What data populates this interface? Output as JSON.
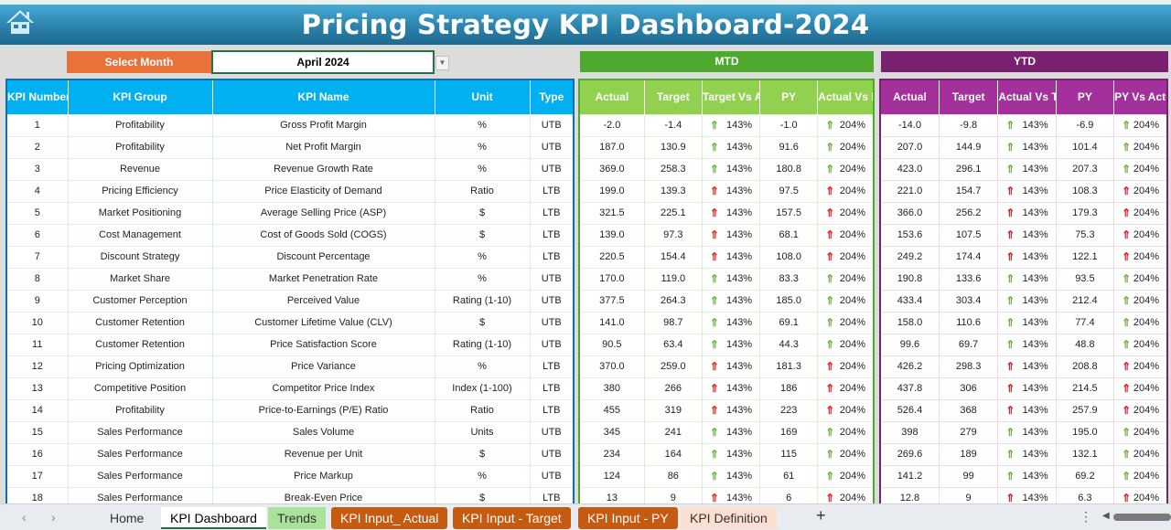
{
  "title": "Pricing Strategy KPI Dashboard-2024",
  "selector": {
    "label": "Select Month",
    "value": "April 2024"
  },
  "sections": {
    "mtd": "MTD",
    "ytd": "YTD"
  },
  "main_headers": [
    "KPI Number",
    "KPI Group",
    "KPI Name",
    "Unit",
    "Type"
  ],
  "mtd_headers": [
    "Actual",
    "Target",
    "Target Vs Actual",
    "PY",
    "Actual Vs PY"
  ],
  "ytd_headers": [
    "Actual",
    "Target",
    "Actual Vs Target",
    "PY",
    "PY Vs Actual"
  ],
  "colors": {
    "good": "#6cb33f",
    "bad": "#e02020",
    "mtd": "#4fa92f",
    "ytd": "#7a2070",
    "main": "#00b0f0",
    "select": "#e9723a"
  },
  "rows": [
    {
      "num": "1",
      "group": "Profitability",
      "name": "Gross Profit Margin",
      "unit": "%",
      "type": "UTB",
      "mtd": [
        "-2.0",
        "-1.4",
        "143%",
        "-1.0",
        "204%"
      ],
      "ytd": [
        "-14.0",
        "-9.8",
        "143%",
        "-6.9",
        "204%"
      ],
      "status": "good"
    },
    {
      "num": "2",
      "group": "Profitability",
      "name": "Net Profit Margin",
      "unit": "%",
      "type": "UTB",
      "mtd": [
        "187.0",
        "130.9",
        "143%",
        "91.6",
        "204%"
      ],
      "ytd": [
        "207.0",
        "144.9",
        "143%",
        "101.4",
        "204%"
      ],
      "status": "good"
    },
    {
      "num": "3",
      "group": "Revenue",
      "name": "Revenue Growth Rate",
      "unit": "%",
      "type": "UTB",
      "mtd": [
        "369.0",
        "258.3",
        "143%",
        "180.8",
        "204%"
      ],
      "ytd": [
        "423.0",
        "296.1",
        "143%",
        "207.3",
        "204%"
      ],
      "status": "good"
    },
    {
      "num": "4",
      "group": "Pricing Efficiency",
      "name": "Price Elasticity of Demand",
      "unit": "Ratio",
      "type": "LTB",
      "mtd": [
        "199.0",
        "139.3",
        "143%",
        "97.5",
        "204%"
      ],
      "ytd": [
        "221.0",
        "154.7",
        "143%",
        "108.3",
        "204%"
      ],
      "status": "bad"
    },
    {
      "num": "5",
      "group": "Market Positioning",
      "name": "Average Selling Price (ASP)",
      "unit": "$",
      "type": "LTB",
      "mtd": [
        "321.5",
        "225.1",
        "143%",
        "157.5",
        "204%"
      ],
      "ytd": [
        "366.0",
        "256.2",
        "143%",
        "179.3",
        "204%"
      ],
      "status": "bad"
    },
    {
      "num": "6",
      "group": "Cost Management",
      "name": "Cost of Goods Sold (COGS)",
      "unit": "$",
      "type": "LTB",
      "mtd": [
        "139.0",
        "97.3",
        "143%",
        "68.1",
        "204%"
      ],
      "ytd": [
        "153.6",
        "107.5",
        "143%",
        "75.3",
        "204%"
      ],
      "status": "bad"
    },
    {
      "num": "7",
      "group": "Discount Strategy",
      "name": "Discount Percentage",
      "unit": "%",
      "type": "LTB",
      "mtd": [
        "220.5",
        "154.4",
        "143%",
        "108.0",
        "204%"
      ],
      "ytd": [
        "249.2",
        "174.4",
        "143%",
        "122.1",
        "204%"
      ],
      "status": "bad"
    },
    {
      "num": "8",
      "group": "Market Share",
      "name": "Market Penetration Rate",
      "unit": "%",
      "type": "UTB",
      "mtd": [
        "170.0",
        "119.0",
        "143%",
        "83.3",
        "204%"
      ],
      "ytd": [
        "190.8",
        "133.6",
        "143%",
        "93.5",
        "204%"
      ],
      "status": "good"
    },
    {
      "num": "9",
      "group": "Customer Perception",
      "name": "Perceived Value",
      "unit": "Rating (1-10)",
      "type": "UTB",
      "mtd": [
        "377.5",
        "264.3",
        "143%",
        "185.0",
        "204%"
      ],
      "ytd": [
        "433.4",
        "303.4",
        "143%",
        "212.4",
        "204%"
      ],
      "status": "good"
    },
    {
      "num": "10",
      "group": "Customer Retention",
      "name": "Customer Lifetime Value (CLV)",
      "unit": "$",
      "type": "UTB",
      "mtd": [
        "141.0",
        "98.7",
        "143%",
        "69.1",
        "204%"
      ],
      "ytd": [
        "158.0",
        "110.6",
        "143%",
        "77.4",
        "204%"
      ],
      "status": "good"
    },
    {
      "num": "11",
      "group": "Customer Retention",
      "name": "Price Satisfaction Score",
      "unit": "Rating (1-10)",
      "type": "UTB",
      "mtd": [
        "90.5",
        "63.4",
        "143%",
        "44.3",
        "204%"
      ],
      "ytd": [
        "99.6",
        "69.7",
        "143%",
        "48.8",
        "204%"
      ],
      "status": "good"
    },
    {
      "num": "12",
      "group": "Pricing Optimization",
      "name": "Price Variance",
      "unit": "%",
      "type": "LTB",
      "mtd": [
        "370.0",
        "259.0",
        "143%",
        "181.3",
        "204%"
      ],
      "ytd": [
        "426.2",
        "298.3",
        "143%",
        "208.8",
        "204%"
      ],
      "status": "bad"
    },
    {
      "num": "13",
      "group": "Competitive Position",
      "name": "Competitor Price Index",
      "unit": "Index (1-100)",
      "type": "LTB",
      "mtd": [
        "380",
        "266",
        "143%",
        "186",
        "204%"
      ],
      "ytd": [
        "437.8",
        "306",
        "143%",
        "214.5",
        "204%"
      ],
      "status": "bad"
    },
    {
      "num": "14",
      "group": "Profitability",
      "name": "Price-to-Earnings (P/E) Ratio",
      "unit": "Ratio",
      "type": "LTB",
      "mtd": [
        "455",
        "319",
        "143%",
        "223",
        "204%"
      ],
      "ytd": [
        "526.4",
        "368",
        "143%",
        "257.9",
        "204%"
      ],
      "status": "bad"
    },
    {
      "num": "15",
      "group": "Sales Performance",
      "name": "Sales Volume",
      "unit": "Units",
      "type": "UTB",
      "mtd": [
        "345",
        "241",
        "143%",
        "169",
        "204%"
      ],
      "ytd": [
        "398",
        "279",
        "143%",
        "195.0",
        "204%"
      ],
      "status": "good"
    },
    {
      "num": "16",
      "group": "Sales Performance",
      "name": "Revenue per Unit",
      "unit": "$",
      "type": "UTB",
      "mtd": [
        "234",
        "164",
        "143%",
        "115",
        "204%"
      ],
      "ytd": [
        "269.6",
        "189",
        "143%",
        "132.1",
        "204%"
      ],
      "status": "good"
    },
    {
      "num": "17",
      "group": "Sales Performance",
      "name": "Price Markup",
      "unit": "%",
      "type": "UTB",
      "mtd": [
        "124",
        "86",
        "143%",
        "61",
        "204%"
      ],
      "ytd": [
        "141.2",
        "99",
        "143%",
        "69.2",
        "204%"
      ],
      "status": "good"
    },
    {
      "num": "18",
      "group": "Sales Performance",
      "name": "Break-Even Price",
      "unit": "$",
      "type": "LTB",
      "mtd": [
        "13",
        "9",
        "143%",
        "6",
        "204%"
      ],
      "ytd": [
        "12.8",
        "9",
        "143%",
        "6.3",
        "204%"
      ],
      "status": "bad"
    }
  ],
  "sheet_tabs": [
    {
      "label": "Home",
      "style": "plain"
    },
    {
      "label": "KPI Dashboard",
      "style": "active"
    },
    {
      "label": "Trends",
      "style": "green"
    },
    {
      "label": "KPI Input_ Actual",
      "style": "orange"
    },
    {
      "label": "KPI Input - Target",
      "style": "orange"
    },
    {
      "label": "KPI Input - PY",
      "style": "orange"
    },
    {
      "label": "KPI Definition",
      "style": "peach"
    }
  ],
  "tabbar": {
    "add": "+",
    "more": "⋮",
    "prev": "‹",
    "next": "›"
  }
}
